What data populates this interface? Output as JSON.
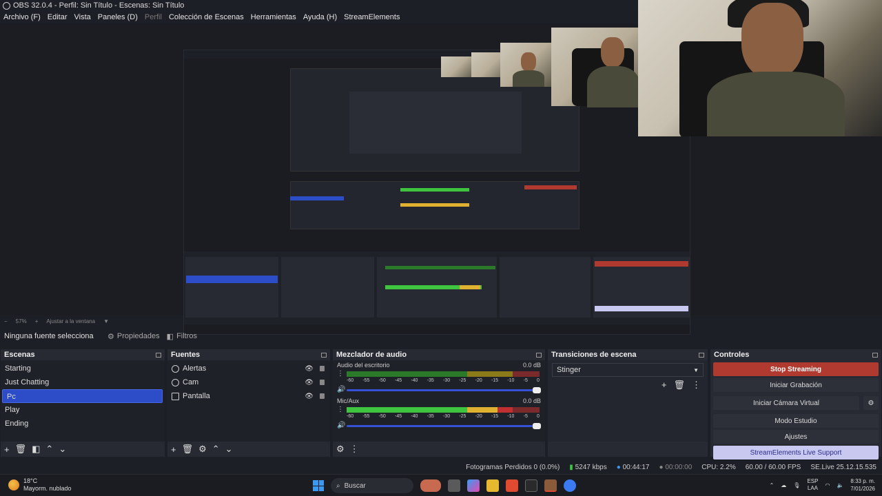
{
  "window": {
    "title": "OBS 32.0.4 - Perfil: Sin Título - Escenas: Sin Título"
  },
  "menu": [
    "Archivo (F)",
    "Editar",
    "Vista",
    "Paneles (D)",
    "Perfil",
    "Colección de Escenas",
    "Herramientas",
    "Ayuda (H)",
    "StreamElements"
  ],
  "zoom": {
    "level": "57%",
    "fit": "Ajustar a la ventana"
  },
  "sourcebar": {
    "label": "Ninguna fuente selecciona",
    "properties": "Propiedades",
    "filters": "Filtros"
  },
  "scenes": {
    "title": "Escenas",
    "items": [
      "Starting",
      "Just Chatting",
      "Pc",
      "Play",
      "Ending"
    ],
    "selected": "Pc"
  },
  "sources": {
    "title": "Fuentes",
    "items": [
      {
        "name": "Alertas",
        "icon": "globe-icon"
      },
      {
        "name": "Cam",
        "icon": "camera-icon"
      },
      {
        "name": "Pantalla",
        "icon": "display-icon"
      }
    ]
  },
  "mixer": {
    "title": "Mezclador de audio",
    "ticks": [
      "-60",
      "-55",
      "-50",
      "-45",
      "-40",
      "-35",
      "-30",
      "-25",
      "-20",
      "-15",
      "-10",
      "-5",
      "0"
    ],
    "channels": [
      {
        "name": "Audio del escritorio",
        "db": "0.0 dB",
        "level": 0.0,
        "volume": 1.0
      },
      {
        "name": "Mic/Aux",
        "db": "0.0 dB",
        "level": 0.78,
        "volume": 1.0
      }
    ]
  },
  "transitions": {
    "title": "Transiciones de escena",
    "selected": "Stinger"
  },
  "controls": {
    "title": "Controles",
    "stop_streaming": "Stop Streaming",
    "start_recording": "Iniciar Grabación",
    "virtual_cam": "Iniciar Cámara Virtual",
    "studio_mode": "Modo Estudio",
    "settings": "Ajustes",
    "support": "StreamElements Live Support"
  },
  "status": {
    "dropped": "Fotogramas Perdidos 0 (0.0%)",
    "bitrate": "5247 kbps",
    "stream_time": "00:44:17",
    "rec_time": "00:00:00",
    "cpu": "CPU: 2.2%",
    "fps": "60.00 / 60.00 FPS",
    "version": "SE.Live 25.12.15.535"
  },
  "taskbar": {
    "temp": "18°C",
    "weather": "Mayorm. nublado",
    "search": "Buscar",
    "lang1": "ESP",
    "lang2": "LAA",
    "time": "8:33 p. m.",
    "date": "7/01/2026"
  },
  "colors": {
    "accent": "#2d4cc7",
    "stop": "#b13a30",
    "support_bg": "#c8c8f0"
  }
}
